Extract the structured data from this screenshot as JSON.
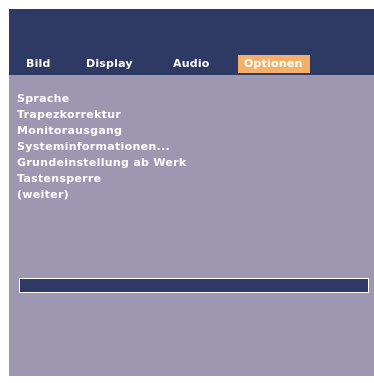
{
  "tabs": [
    {
      "label": "Bild",
      "active": false
    },
    {
      "label": "Display",
      "active": false
    },
    {
      "label": "Audio",
      "active": false
    },
    {
      "label": "Optionen",
      "active": true
    }
  ],
  "menu_items": [
    "Sprache",
    "Trapezkorrektur",
    "Monitorausgang",
    "Systeminformationen...",
    "Grundeinstellung ab Werk",
    "Tastensperre",
    "(weiter)"
  ],
  "colors": {
    "header": "#2e3a63",
    "panel": "#9d97b1",
    "active_tab": "#f4b06a",
    "text": "#ffffff"
  }
}
